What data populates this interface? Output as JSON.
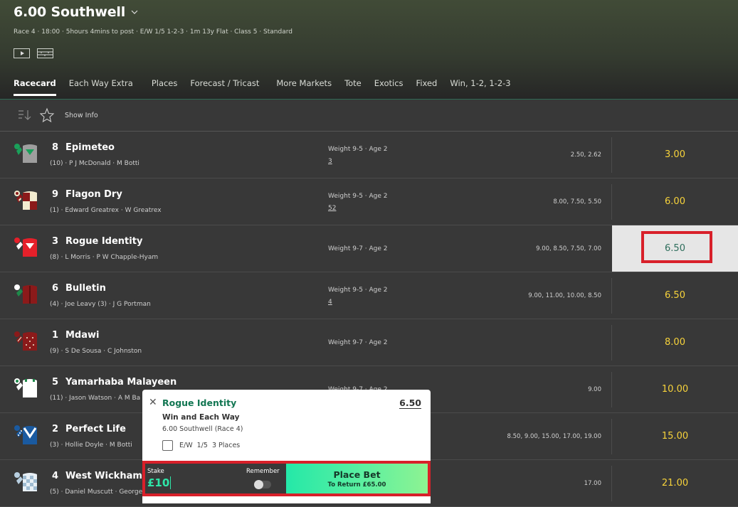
{
  "header": {
    "title": "6.00 Southwell",
    "subinfo": "Race 4 · 18:00 · 5hours 4mins to post · E/W 1/5 1-2-3 · 1m 13y Flat · Class 5 · Standard",
    "media_icons": [
      "play-video-icon",
      "racecourse-map-icon"
    ]
  },
  "tabs": [
    {
      "label": "Racecard",
      "active": true
    },
    {
      "label": "Each Way Extra"
    },
    {
      "label": "Places"
    },
    {
      "label": "Forecast / Tricast"
    },
    {
      "label": "More Markets"
    },
    {
      "label": "Tote"
    },
    {
      "label": "Exotics"
    },
    {
      "label": "Fixed"
    },
    {
      "label": "Win, 1-2, 1-2-3"
    }
  ],
  "toolbar": {
    "show_info_label": "Show Info"
  },
  "colors": {
    "odds": "#f7d33b",
    "selected_odds": "#2e6e5c",
    "accent_green": "#127652",
    "highlight_red": "#d8202a"
  },
  "runners": [
    {
      "num": "8",
      "name": "Epimeteo",
      "sub": "(10) · P J McDonald · M Botti",
      "weight": "Weight 9-5 · Age 2",
      "form": "3",
      "prev": "2.50, 2.62",
      "odds": "3.00"
    },
    {
      "num": "9",
      "name": "Flagon Dry",
      "sub": "(1) · Edward Greatrex · W Greatrex",
      "weight": "Weight 9-5 · Age 2",
      "form": "52",
      "prev": "8.00, 7.50, 5.50",
      "odds": "6.00"
    },
    {
      "num": "3",
      "name": "Rogue Identity",
      "sub": "(8) · L Morris · P W Chapple-Hyam",
      "weight": "Weight 9-7 · Age 2",
      "form": "",
      "prev": "9.00, 8.50, 7.50, 7.00",
      "odds": "6.50",
      "selected": true
    },
    {
      "num": "6",
      "name": "Bulletin",
      "sub": "(4) · Joe Leavy (3) · J G Portman",
      "weight": "Weight 9-5 · Age 2",
      "form": "4",
      "prev": "9.00, 11.00, 10.00, 8.50",
      "odds": "6.50"
    },
    {
      "num": "1",
      "name": "Mdawi",
      "sub": "(9) · S De Sousa · C Johnston",
      "weight": "Weight 9-7 · Age 2",
      "form": "",
      "prev": "",
      "odds": "8.00"
    },
    {
      "num": "5",
      "name": "Yamarhaba Malayeen",
      "sub": "(11) · Jason Watson · A M Ba",
      "weight": "Weight 9-7 · Age 2",
      "form": "",
      "prev": "9.00",
      "odds": "10.00"
    },
    {
      "num": "2",
      "name": "Perfect Life",
      "sub": "(3) · Hollie Doyle · M Botti",
      "weight": "",
      "form": "",
      "prev": "8.50, 9.00, 15.00, 17.00, 19.00",
      "odds": "15.00"
    },
    {
      "num": "4",
      "name": "West Wickham",
      "sub": "(5) · Daniel Muscutt · George",
      "weight": "",
      "form": "",
      "prev": "17.00",
      "odds": "21.00"
    }
  ],
  "betslip": {
    "selection": "Rogue Identity",
    "price": "6.50",
    "bet_type": "Win and Each Way",
    "event": "6.00 Southwell (Race 4)",
    "ew_label": "E/W  1/5  3 Places",
    "ew_checked": false,
    "stake_label": "Stake",
    "stake_value": "£10",
    "remember_label": "Remember",
    "remember_on": false,
    "place_bet_label": "Place Bet",
    "to_return": "To Return £65.00"
  }
}
